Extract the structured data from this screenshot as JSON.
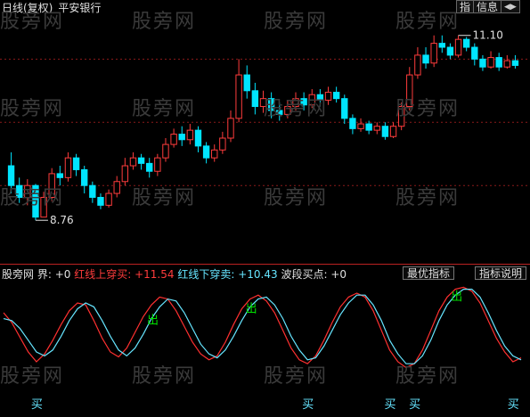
{
  "header": {
    "period_label": "日线(复权)",
    "stock_name": "平安银行",
    "btn_index": "指",
    "btn_info": "信息",
    "btn_arrows": "◀▶"
  },
  "watermark": "股旁网",
  "colors": {
    "up": "#ff3c3c",
    "down": "#00e5ff",
    "grid": "#8b1a1a",
    "yellow": "#e8e800",
    "white": "#e0e0e0",
    "green": "#00e000"
  },
  "indicator_bar": {
    "name": "股旁网",
    "jie": "界: +0",
    "red_up_label": "红线上穿买:",
    "red_up_value": "+11.54",
    "red_down_label": "红线下穿卖:",
    "red_down_value": "+10.43",
    "wave_label": "波段买点:",
    "wave_value": "+0",
    "btn_best": "最优指标",
    "btn_explain": "指标说明"
  },
  "markers": {
    "buy": "买",
    "sell": "出"
  },
  "chart_data": [
    {
      "type": "candlestick",
      "title": "平安银行 日线(复权)",
      "annotations": [
        {
          "label": "11.10",
          "kind": "max",
          "index": 55
        },
        {
          "label": "8.76",
          "kind": "min",
          "index": 3
        }
      ],
      "ylim": [
        8.3,
        11.3
      ],
      "grid": true,
      "candles": [
        [
          9.45,
          9.2,
          9.62,
          9.1
        ],
        [
          9.2,
          9.05,
          9.3,
          8.98
        ],
        [
          9.05,
          9.2,
          9.28,
          8.95
        ],
        [
          9.2,
          8.8,
          9.22,
          8.76
        ],
        [
          8.8,
          9.05,
          9.12,
          8.8
        ],
        [
          9.05,
          9.35,
          9.42,
          9.0
        ],
        [
          9.35,
          9.3,
          9.45,
          9.2
        ],
        [
          9.3,
          9.55,
          9.62,
          9.25
        ],
        [
          9.55,
          9.4,
          9.6,
          9.32
        ],
        [
          9.4,
          9.2,
          9.45,
          9.1
        ],
        [
          9.2,
          9.05,
          9.25,
          8.98
        ],
        [
          9.05,
          8.95,
          9.1,
          8.9
        ],
        [
          8.95,
          9.1,
          9.15,
          8.92
        ],
        [
          9.1,
          9.25,
          9.32,
          9.05
        ],
        [
          9.25,
          9.45,
          9.55,
          9.2
        ],
        [
          9.45,
          9.55,
          9.62,
          9.4
        ],
        [
          9.55,
          9.48,
          9.6,
          9.4
        ],
        [
          9.48,
          9.38,
          9.55,
          9.3
        ],
        [
          9.38,
          9.55,
          9.6,
          9.32
        ],
        [
          9.55,
          9.72,
          9.8,
          9.5
        ],
        [
          9.72,
          9.85,
          9.92,
          9.68
        ],
        [
          9.85,
          9.78,
          9.95,
          9.7
        ],
        [
          9.78,
          9.9,
          9.98,
          9.72
        ],
        [
          9.9,
          9.7,
          9.95,
          9.62
        ],
        [
          9.7,
          9.55,
          9.75,
          9.48
        ],
        [
          9.55,
          9.65,
          9.72,
          9.5
        ],
        [
          9.65,
          9.8,
          9.88,
          9.6
        ],
        [
          9.8,
          10.05,
          10.15,
          9.75
        ],
        [
          10.05,
          10.6,
          10.8,
          10.0
        ],
        [
          10.6,
          10.4,
          10.72,
          10.3
        ],
        [
          10.4,
          10.2,
          10.5,
          10.1
        ],
        [
          10.2,
          10.3,
          10.4,
          10.12
        ],
        [
          10.3,
          10.15,
          10.38,
          10.05
        ],
        [
          10.15,
          10.1,
          10.25,
          10.02
        ],
        [
          10.1,
          10.2,
          10.28,
          10.05
        ],
        [
          10.2,
          10.3,
          10.38,
          10.15
        ],
        [
          10.3,
          10.22,
          10.38,
          10.15
        ],
        [
          10.22,
          10.35,
          10.42,
          10.18
        ],
        [
          10.35,
          10.28,
          10.42,
          10.2
        ],
        [
          10.28,
          10.38,
          10.45,
          10.22
        ],
        [
          10.38,
          10.3,
          10.45,
          10.25
        ],
        [
          10.3,
          10.05,
          10.35,
          9.98
        ],
        [
          10.05,
          9.92,
          10.1,
          9.85
        ],
        [
          9.92,
          9.98,
          10.05,
          9.88
        ],
        [
          9.98,
          9.9,
          10.02,
          9.85
        ],
        [
          9.9,
          9.95,
          10.0,
          9.85
        ],
        [
          9.95,
          9.82,
          10.0,
          9.78
        ],
        [
          9.82,
          9.95,
          10.0,
          9.8
        ],
        [
          9.95,
          10.2,
          10.25,
          9.9
        ],
        [
          10.2,
          10.6,
          10.7,
          10.15
        ],
        [
          10.6,
          10.85,
          10.95,
          10.55
        ],
        [
          10.85,
          10.75,
          10.95,
          10.68
        ],
        [
          10.75,
          11.0,
          11.1,
          10.7
        ],
        [
          11.0,
          10.95,
          11.1,
          10.88
        ],
        [
          10.95,
          10.85,
          11.0,
          10.8
        ],
        [
          10.85,
          11.05,
          11.1,
          10.82
        ],
        [
          11.05,
          10.95,
          11.08,
          10.9
        ],
        [
          10.95,
          10.8,
          11.0,
          10.72
        ],
        [
          10.8,
          10.7,
          10.85,
          10.65
        ],
        [
          10.7,
          10.82,
          10.9,
          10.68
        ],
        [
          10.82,
          10.7,
          10.88,
          10.65
        ],
        [
          10.7,
          10.78,
          10.85,
          10.68
        ],
        [
          10.78,
          10.72,
          10.85,
          10.68
        ]
      ]
    },
    {
      "type": "line",
      "title": "",
      "series": [
        {
          "color": "#ff3030",
          "values": [
            70,
            60,
            45,
            30,
            20,
            28,
            42,
            58,
            72,
            80,
            78,
            62,
            44,
            30,
            25,
            34,
            50,
            66,
            78,
            86,
            84,
            72,
            56,
            40,
            28,
            22,
            26,
            40,
            58,
            74,
            84,
            88,
            82,
            70,
            52,
            34,
            22,
            18,
            26,
            42,
            60,
            76,
            86,
            90,
            86,
            72,
            52,
            32,
            20,
            14,
            18,
            32,
            52,
            72,
            86,
            94,
            96,
            92,
            80,
            62,
            44,
            30,
            20,
            24
          ]
        },
        {
          "color": "#66e5ff",
          "values": [
            64,
            62,
            54,
            42,
            30,
            26,
            32,
            46,
            62,
            74,
            80,
            76,
            62,
            46,
            32,
            26,
            34,
            48,
            64,
            76,
            84,
            82,
            70,
            54,
            38,
            28,
            24,
            32,
            46,
            62,
            76,
            84,
            86,
            78,
            64,
            46,
            32,
            22,
            24,
            36,
            52,
            68,
            80,
            88,
            88,
            78,
            62,
            42,
            28,
            18,
            18,
            26,
            42,
            62,
            78,
            88,
            94,
            94,
            86,
            70,
            52,
            36,
            26,
            22
          ]
        }
      ]
    }
  ]
}
